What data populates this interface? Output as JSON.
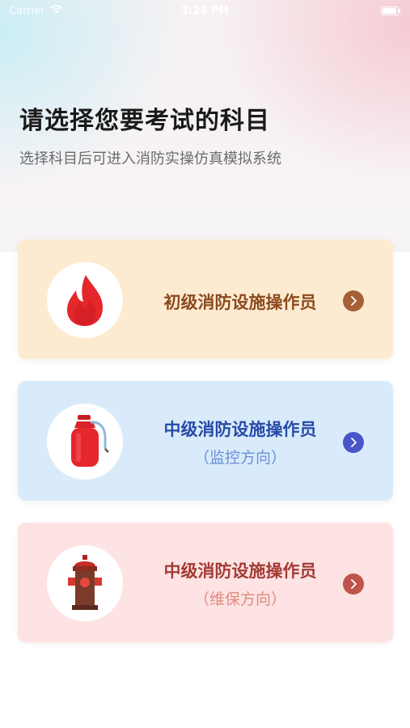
{
  "status_bar": {
    "carrier": "Carrier",
    "time": "3:24 PM",
    "wifi_icon": "wifi-icon",
    "battery_icon": "battery-icon"
  },
  "header": {
    "title": "请选择您要考试的科目",
    "subtitle": "选择科目后可进入消防实操仿真模拟系统"
  },
  "subjects": [
    {
      "title": "初级消防设施操作员",
      "subtitle": "",
      "icon": "flame-icon",
      "arrow_icon": "chevron-right-icon",
      "background": "#fdebd1",
      "arrow_color": "#a65f36"
    },
    {
      "title": "中级消防设施操作员",
      "subtitle": "（监控方向）",
      "icon": "fire-extinguisher-icon",
      "arrow_icon": "chevron-right-icon",
      "background": "#d9ebfa",
      "arrow_color": "#4a55c8"
    },
    {
      "title": "中级消防设施操作员",
      "subtitle": "（维保方向）",
      "icon": "fire-hydrant-icon",
      "arrow_icon": "chevron-right-icon",
      "background": "#fde3e3",
      "arrow_color": "#c0544c"
    }
  ]
}
